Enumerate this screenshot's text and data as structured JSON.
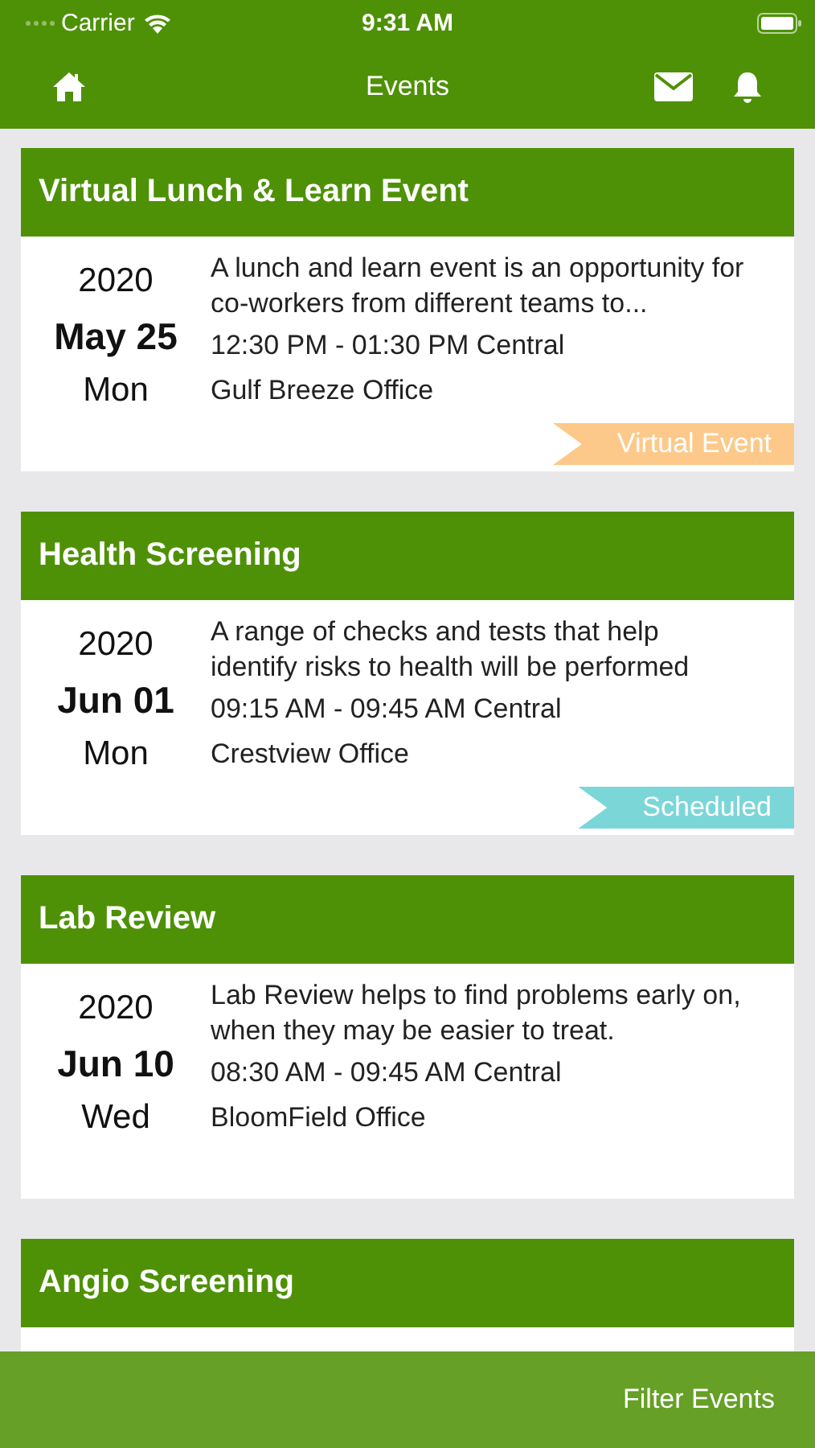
{
  "status_bar": {
    "carrier": "Carrier",
    "time": "9:31 AM"
  },
  "nav": {
    "title": "Events"
  },
  "events": [
    {
      "title": "Virtual Lunch & Learn Event",
      "year": "2020",
      "date": "May 25",
      "weekday": "Mon",
      "description": "A lunch and learn event is an opportunity for co-workers from different teams to...",
      "time": "12:30 PM - 01:30 PM Central",
      "location": "Gulf Breeze Office",
      "tag": {
        "label": "Virtual Event",
        "color": "#fdc98a"
      }
    },
    {
      "title": "Health Screening",
      "year": "2020",
      "date": "Jun 01",
      "weekday": "Mon",
      "description": "A range of checks and tests that help identify risks to health will be performed",
      "time": "09:15 AM - 09:45 AM Central",
      "location": "Crestview Office",
      "tag": {
        "label": "Scheduled",
        "color": "#7bd6d8"
      }
    },
    {
      "title": "Lab Review",
      "year": "2020",
      "date": "Jun 10",
      "weekday": "Wed",
      "description": "Lab Review helps to find problems early on, when they may be easier to treat.",
      "time": "08:30 AM - 09:45 AM Central",
      "location": "BloomField Office"
    },
    {
      "title": "Angio Screening"
    }
  ],
  "bottom_bar": {
    "action": "Filter Events"
  }
}
